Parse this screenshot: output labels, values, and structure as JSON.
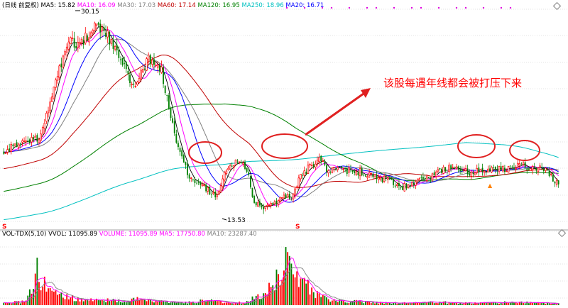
{
  "header": {
    "title": "(日线 前复权)",
    "ma_labels": [
      {
        "text": "MA5: 15.82",
        "color": "#000000"
      },
      {
        "text": "MA10: 16.09",
        "color": "#ff00ff"
      },
      {
        "text": "MA30: 17.03",
        "color": "#808080"
      },
      {
        "text": "MA60: 17.14",
        "color": "#c00000"
      },
      {
        "text": "MA120: 16.95",
        "color": "#008000"
      },
      {
        "text": "MA250: 18.96",
        "color": "#00c0c0"
      },
      {
        "text": "MA20: 16.71",
        "color": "#0000ff"
      }
    ]
  },
  "volume_header": {
    "labels": [
      {
        "text": "VOL-TDX(5,10)",
        "color": "#000000"
      },
      {
        "text": "VVOL: 11095.89",
        "color": "#000000"
      },
      {
        "text": "VOLUME: 11095.89",
        "color": "#ff00ff"
      },
      {
        "text": "MA5: 17750.80",
        "color": "#ff00ff"
      },
      {
        "text": "MA10: 23287.40",
        "color": "#808080"
      }
    ]
  },
  "annotation": {
    "text": "该股每遇年线都会被打压下来",
    "color": "#ff0000"
  },
  "markers": {
    "high_label": "30.15",
    "low_label": "13.53",
    "s_label": "S",
    "triangle_label": "▲"
  },
  "colors": {
    "up": "#ff0000",
    "down": "#008000",
    "ma5": "#000000",
    "ma10": "#ff00ff",
    "ma20": "#0000ff",
    "ma30": "#808080",
    "ma60": "#c00000",
    "ma120": "#008000",
    "ma250": "#00c0c0",
    "grid": "#c8c8c8",
    "circle": "#e02020"
  },
  "chart_data": [
    {
      "type": "candlestick",
      "ylim": [
        12.5,
        31.5
      ],
      "key_points": {
        "high": 30.15,
        "low": 13.53
      },
      "price_path_anchors": [
        [
          0,
          19.0
        ],
        [
          10,
          19.8
        ],
        [
          20,
          20.2
        ],
        [
          28,
          25.2
        ],
        [
          35,
          28.8
        ],
        [
          42,
          28.6
        ],
        [
          50,
          30.0
        ],
        [
          58,
          28.8
        ],
        [
          66,
          26.0
        ],
        [
          70,
          25.0
        ],
        [
          78,
          27.0
        ],
        [
          85,
          26.0
        ],
        [
          93,
          20.0
        ],
        [
          100,
          16.8
        ],
        [
          108,
          15.8
        ],
        [
          115,
          15.0
        ],
        [
          121,
          17.8
        ],
        [
          126,
          18.2
        ],
        [
          131,
          17.5
        ],
        [
          135,
          14.6
        ],
        [
          140,
          14.0
        ],
        [
          145,
          14.3
        ],
        [
          150,
          15.2
        ],
        [
          155,
          15.0
        ],
        [
          160,
          16.8
        ],
        [
          165,
          17.7
        ],
        [
          170,
          18.3
        ],
        [
          175,
          17.2
        ],
        [
          180,
          17.4
        ],
        [
          190,
          17.3
        ],
        [
          200,
          16.9
        ],
        [
          210,
          16.2
        ],
        [
          215,
          15.9
        ],
        [
          220,
          16.2
        ],
        [
          228,
          16.6
        ],
        [
          234,
          17.4
        ],
        [
          240,
          17.5
        ],
        [
          246,
          17.3
        ],
        [
          252,
          17.2
        ],
        [
          260,
          17.3
        ],
        [
          268,
          17.5
        ],
        [
          274,
          17.6
        ],
        [
          280,
          17.7
        ],
        [
          286,
          17.6
        ],
        [
          290,
          17.5
        ],
        [
          294,
          17.0
        ],
        [
          299,
          16.0
        ]
      ],
      "n_bars": 300,
      "seed": 20230417
    },
    {
      "type": "bar",
      "name": "volume",
      "ylim": [
        0,
        110000
      ],
      "volume_anchors": [
        [
          0,
          4000
        ],
        [
          12,
          6000
        ],
        [
          16,
          40000
        ],
        [
          20,
          30000
        ],
        [
          26,
          20000
        ],
        [
          32,
          16000
        ],
        [
          40,
          9000
        ],
        [
          50,
          8000
        ],
        [
          60,
          8000
        ],
        [
          66,
          6000
        ],
        [
          72,
          10000
        ],
        [
          80,
          7000
        ],
        [
          88,
          5000
        ],
        [
          96,
          4000
        ],
        [
          110,
          8000
        ],
        [
          120,
          5000
        ],
        [
          130,
          4000
        ],
        [
          142,
          25000
        ],
        [
          147,
          35000
        ],
        [
          152,
          85000
        ],
        [
          156,
          55000
        ],
        [
          162,
          35000
        ],
        [
          168,
          18000
        ],
        [
          176,
          9000
        ],
        [
          184,
          7000
        ],
        [
          196,
          5000
        ],
        [
          206,
          4000
        ],
        [
          220,
          3500
        ],
        [
          232,
          5000
        ],
        [
          240,
          4500
        ],
        [
          252,
          3500
        ],
        [
          264,
          4000
        ],
        [
          276,
          5000
        ],
        [
          286,
          4000
        ],
        [
          299,
          3000
        ]
      ],
      "spikes": [
        [
          18,
          80000
        ],
        [
          152,
          98000
        ],
        [
          155,
          70000
        ],
        [
          147,
          60000
        ],
        [
          22,
          48000
        ]
      ]
    }
  ]
}
